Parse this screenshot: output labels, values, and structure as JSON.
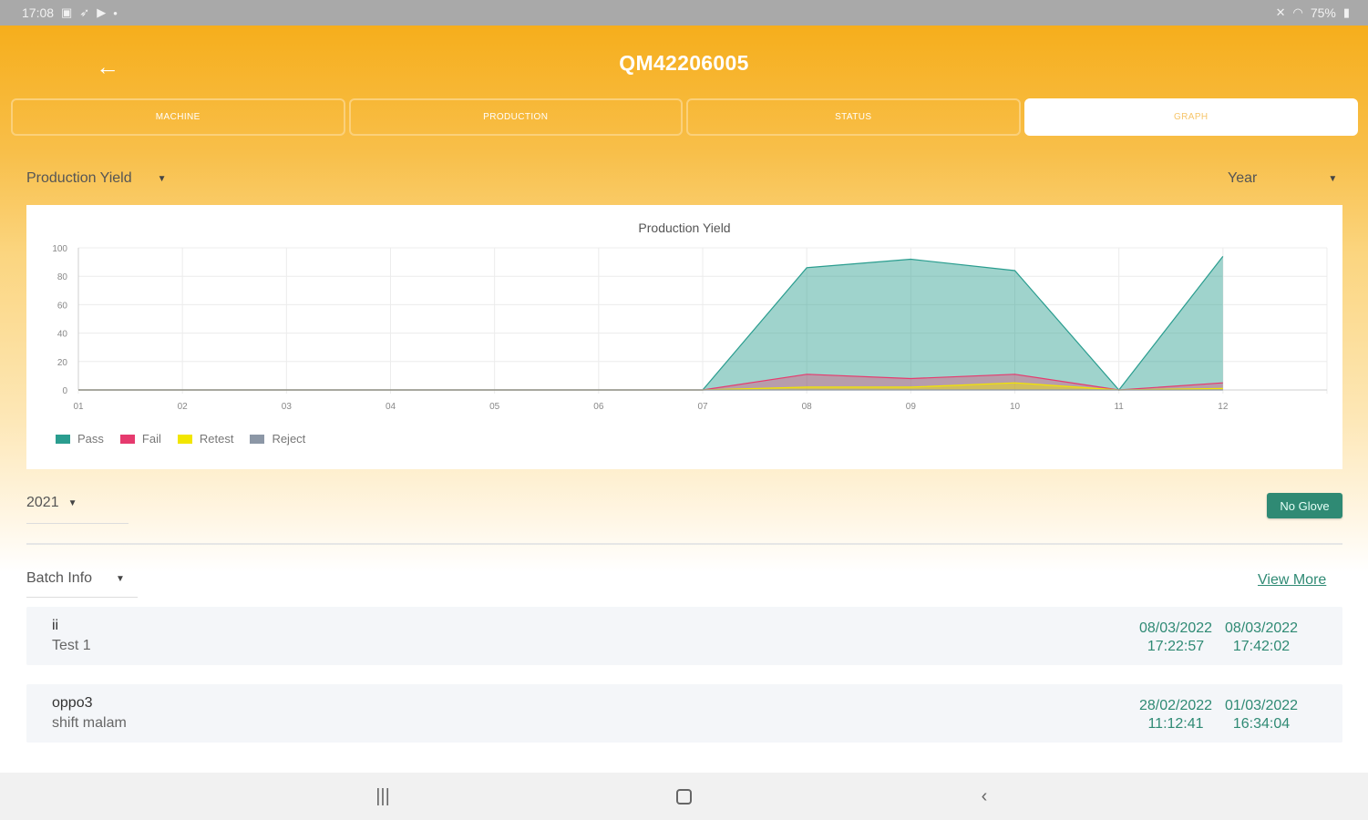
{
  "status_bar": {
    "time": "17:08",
    "left_icons": [
      "image-icon",
      "send-icon",
      "youtube-icon",
      "dot-icon"
    ],
    "battery": "75%",
    "right_icons": [
      "mute-icon",
      "wifi-icon",
      "battery-icon"
    ]
  },
  "header": {
    "back_icon": "arrow-left-icon",
    "title": "QM42206005"
  },
  "tabs": [
    {
      "label": "MACHINE",
      "active": false
    },
    {
      "label": "PRODUCTION",
      "active": false
    },
    {
      "label": "STATUS",
      "active": false
    },
    {
      "label": "GRAPH",
      "active": true
    }
  ],
  "filters": {
    "metric": "Production Yield",
    "period": "Year"
  },
  "chart_data": {
    "type": "area",
    "title": "Production Yield",
    "categories": [
      "01",
      "02",
      "03",
      "04",
      "05",
      "06",
      "07",
      "08",
      "09",
      "10",
      "11",
      "12"
    ],
    "ylim": [
      0,
      100
    ],
    "yticks": [
      0,
      20,
      40,
      60,
      80,
      100
    ],
    "grid": true,
    "legend_position": "bottom-left",
    "series": [
      {
        "name": "Pass",
        "color": "#2a9d8f",
        "values": [
          0,
          0,
          0,
          0,
          0,
          0,
          0,
          86,
          92,
          84,
          0,
          94
        ]
      },
      {
        "name": "Fail",
        "color": "#e63a6e",
        "values": [
          0,
          0,
          0,
          0,
          0,
          0,
          0,
          11,
          8,
          11,
          0,
          5
        ]
      },
      {
        "name": "Retest",
        "color": "#f2e600",
        "values": [
          0,
          0,
          0,
          0,
          0,
          0,
          0,
          2,
          2,
          5,
          0,
          1
        ]
      },
      {
        "name": "Reject",
        "color": "#8c97a6",
        "values": [
          0,
          0,
          0,
          0,
          0,
          0,
          0,
          0,
          0,
          0,
          0,
          0
        ]
      }
    ]
  },
  "year_filter": "2021",
  "no_glove_button": "No Glove",
  "batch": {
    "dropdown_label": "Batch Info",
    "view_more": "View More",
    "rows": [
      {
        "name": "ii",
        "sub": "Test 1",
        "start_date": "08/03/2022",
        "start_time": "17:22:57",
        "end_date": "08/03/2022",
        "end_time": "17:42:02"
      },
      {
        "name": "oppo3",
        "sub": "shift malam",
        "start_date": "28/02/2022",
        "start_time": "11:12:41",
        "end_date": "01/03/2022",
        "end_time": "16:34:04"
      }
    ]
  },
  "nav": {
    "recents_icon": "recents-icon",
    "home_icon": "home-icon",
    "back_icon": "back-icon"
  }
}
